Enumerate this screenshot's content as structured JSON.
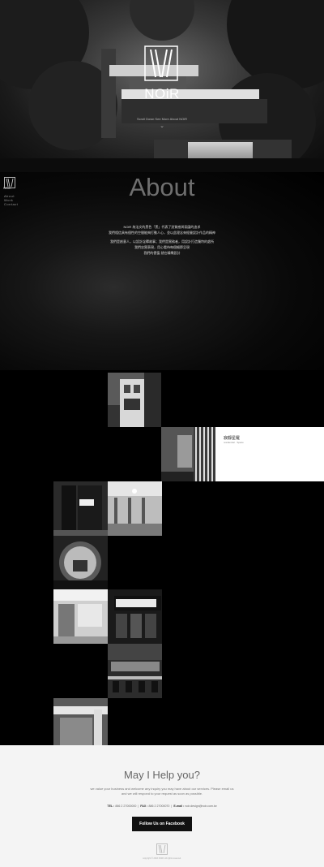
{
  "hero": {
    "brand": "NOiR",
    "tagline": "Scroll Down See More About NOiR",
    "scroll_icon": "chevron-down-icon"
  },
  "sidebar": {
    "brand": "NOiR",
    "nav": [
      "About",
      "Work",
      "Contact"
    ]
  },
  "about": {
    "title": "About",
    "paragraphs": [
      "NOiR 為法文的黑色「黑」代表了對質感與氛圍的追求",
      "我們相信具有個性的空間能夠打動人心，並以此理念來經營設計作品的精神",
      "我們是創意人，以設計詮釋故事；我們是實務者，用設計打造獨特的處所",
      "我們忠實表現，用心看待每個細節呈現",
      "我們的價值 就在精緻設計"
    ]
  },
  "work": {
    "caption_title": "寂靜星羅",
    "caption_sub": "residential · Space"
  },
  "contact": {
    "title": "May I Help you?",
    "desc": "we value your business and welcome any inquiry you may have about our services. Please email us and we will respond to your request as soon as possible.",
    "tel_label": "TEL :",
    "tel": "886 2 27000000",
    "fax_label": "FAX :",
    "fax": "886 2 27000070",
    "email_label": "E-mail :",
    "email": "noir.design@noir.com.tw",
    "facebook_button": "Follow Us on Facebook",
    "footer_brand": "NOiR",
    "copyright": "copyright © 2016 NOiR. All rights reserved."
  }
}
